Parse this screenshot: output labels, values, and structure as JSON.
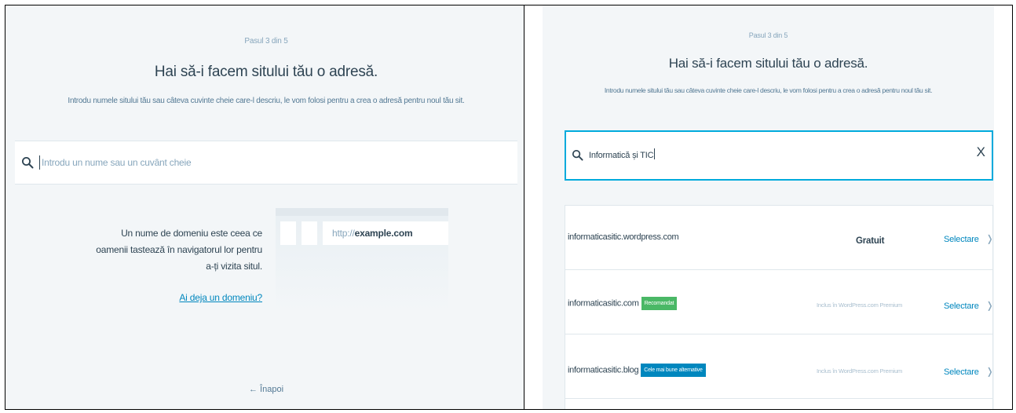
{
  "left": {
    "step": "Pasul 3 din 5",
    "title": "Hai să-i facem sitului tău o adresă.",
    "subtitle": "Introdu numele sitului tău sau câteva cuvinte cheie care-l descriu, le vom folosi pentru a crea o adresă pentru noul tău sit.",
    "search_placeholder": "Introdu un nume sau un cuvânt cheie",
    "info_text": "Un nume de domeniu este ceea ce oamenii tastează în navigatorul lor pentru a-ți vizita situl.",
    "have_domain_link": "Ai deja un domeniu?",
    "browser_url_prefix": "http://",
    "browser_url_domain": "example.com",
    "back_label": "← Înapoi"
  },
  "right": {
    "step": "Pasul 3 din 5",
    "title": "Hai să-i facem sitului tău o adresă.",
    "subtitle": "Introdu numele sitului tău sau câteva cuvinte cheie care-l descriu, le vom folosi pentru a crea o adresă pentru noul tău sit.",
    "search_value": "Informatică și TIC",
    "clear_label": "X",
    "results": [
      {
        "domain": "informaticasitic.wordpress.com",
        "badge": "",
        "price": "Gratuit",
        "select": "Selectare"
      },
      {
        "domain": "informaticasitic.com",
        "badge": "Recomandat",
        "price": "Inclus în WordPress.com Premium",
        "select": "Selectare"
      },
      {
        "domain": "informaticasitic.blog",
        "badge": "Cele mai bune alternative",
        "price": "Inclus în WordPress.com Premium",
        "select": "Selectare"
      }
    ]
  },
  "colors": {
    "accent": "#0087be",
    "focus_border": "#00aadc",
    "badge_recommended": "#4ab866",
    "badge_alternative": "#0087be",
    "background": "#f3f6f8"
  }
}
